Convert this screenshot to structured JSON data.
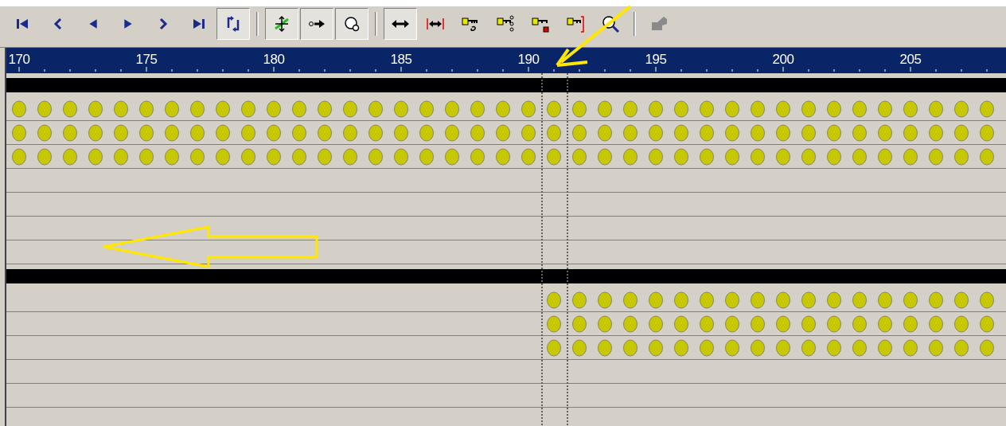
{
  "toolbar": [
    {
      "kind": "go-start",
      "pressed": false
    },
    {
      "kind": "prev-frame",
      "pressed": false
    },
    {
      "kind": "play-reverse",
      "pressed": false
    },
    {
      "kind": "play",
      "pressed": false
    },
    {
      "kind": "next-frame",
      "pressed": false
    },
    {
      "kind": "go-end",
      "pressed": false
    },
    {
      "kind": "loop",
      "pressed": true
    },
    {
      "kind": "separator"
    },
    {
      "kind": "slide",
      "pressed": true
    },
    {
      "kind": "key-arrow",
      "pressed": true
    },
    {
      "kind": "sphere",
      "pressed": true
    },
    {
      "kind": "separator"
    },
    {
      "kind": "double-arrow",
      "pressed": true
    },
    {
      "kind": "bounded-arrow",
      "pressed": false
    },
    {
      "kind": "key-curve",
      "pressed": false
    },
    {
      "kind": "key-chain",
      "pressed": false
    },
    {
      "kind": "key-dot",
      "pressed": false
    },
    {
      "kind": "key-bracket",
      "pressed": false
    },
    {
      "kind": "zoom",
      "pressed": false
    },
    {
      "kind": "separator"
    },
    {
      "kind": "key-tool",
      "pressed": false,
      "disabled": true
    }
  ],
  "ruler": {
    "labels": [
      "170",
      "175",
      "180",
      "185",
      "190",
      "195",
      "200",
      "205"
    ]
  },
  "tracks": [
    {
      "kind": "range"
    },
    {
      "kind": "keys",
      "partial": false
    },
    {
      "kind": "keys",
      "partial": false
    },
    {
      "kind": "keys",
      "partial": false
    },
    {
      "kind": "empty"
    },
    {
      "kind": "empty"
    },
    {
      "kind": "empty"
    },
    {
      "kind": "empty"
    },
    {
      "kind": "range"
    },
    {
      "kind": "keys",
      "partial": true
    },
    {
      "kind": "keys",
      "partial": true
    },
    {
      "kind": "keys",
      "partial": true
    },
    {
      "kind": "empty"
    },
    {
      "kind": "empty"
    },
    {
      "kind": "empty"
    }
  ],
  "annotations": {
    "diagonal_arrow": true,
    "left_arrow": true
  }
}
